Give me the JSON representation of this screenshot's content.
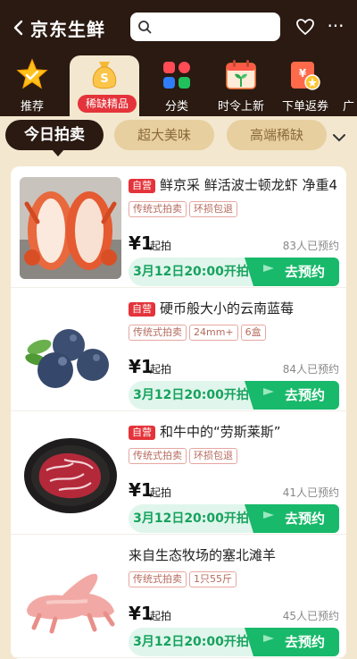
{
  "header": {
    "title": "京东生鲜",
    "search_placeholder": ""
  },
  "categories": [
    {
      "label": "推荐"
    },
    {
      "label": "稀缺精品"
    },
    {
      "label": "分类"
    },
    {
      "label": "时令上新"
    },
    {
      "label": "下单返券"
    },
    {
      "label": "广"
    }
  ],
  "tabs": {
    "today": "今日拍卖",
    "t1": "超大美味",
    "t2": "高端稀缺"
  },
  "products": [
    {
      "self": "自营",
      "title": "鲜京采 鲜活波士顿龙虾 净重4",
      "tags": [
        "传统式拍卖",
        "环损包退"
      ],
      "price": "¥1",
      "unit": "起拍",
      "reserved": "83人已预约",
      "date": "3月12日20:00开拍",
      "button": "去预约"
    },
    {
      "self": "自营",
      "title": "硬币般大小的云南蓝莓",
      "tags": [
        "传统式拍卖",
        "24mm+",
        "6盒"
      ],
      "price": "¥1",
      "unit": "起拍",
      "reserved": "84人已预约",
      "date": "3月12日20:00开拍",
      "button": "去预约"
    },
    {
      "self": "自营",
      "title": "和牛中的“劳斯莱斯”",
      "tags": [
        "传统式拍卖",
        "环损包退"
      ],
      "price": "¥1",
      "unit": "起拍",
      "reserved": "41人已预约",
      "date": "3月12日20:00开拍",
      "button": "去预约"
    },
    {
      "self": "",
      "title": "来自生态牧场的塞北滩羊",
      "tags": [
        "传统式拍卖",
        "1只55斤"
      ],
      "price": "¥1",
      "unit": "起拍",
      "reserved": "45人已预约",
      "date": "3月12日20:00开拍",
      "button": "去预约"
    }
  ],
  "colors": {
    "header_bg": "#2a1a12",
    "accent_red": "#e4333a",
    "accent_green": "#18b96a",
    "page_bg": "#f3e7cf"
  }
}
